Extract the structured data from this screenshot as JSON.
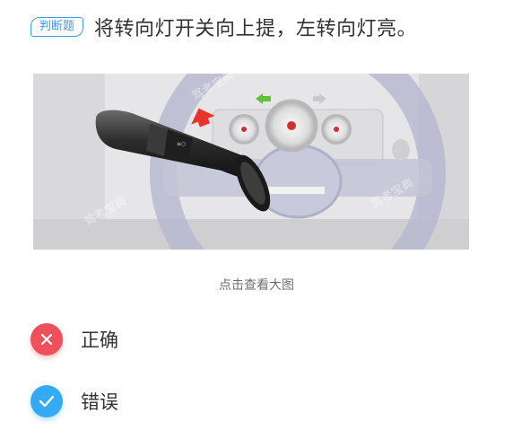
{
  "question": {
    "tag": "判断题",
    "text": "将转向灯开关向上提，左转向灯亮。"
  },
  "image": {
    "caption": "点击查看大图",
    "watermark": "驾考宝典",
    "colors": {
      "arrow_red": "#e8332b",
      "indicator_green": "#5fc23a"
    }
  },
  "options": [
    {
      "label": "正确",
      "icon": "close-icon",
      "color": "#f0505a"
    },
    {
      "label": "错误",
      "icon": "check-icon",
      "color": "#33aaf3"
    }
  ]
}
